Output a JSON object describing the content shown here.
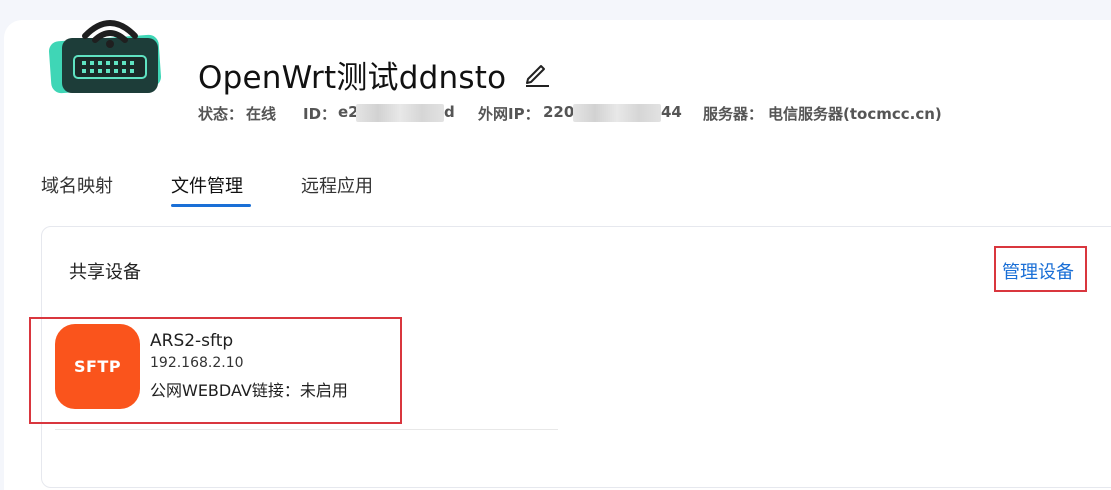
{
  "device": {
    "name": "OpenWrt测试ddnsto",
    "status_label": "状态：",
    "status_value": "在线",
    "id_label": "ID：",
    "id_prefix": "e2",
    "id_suffix": "d",
    "ip_label": "外网IP：",
    "ip_prefix": "220",
    "ip_suffix": "44",
    "server_label": "服务器：",
    "server_value": "电信服务器(tocmcc.cn)"
  },
  "tabs": [
    {
      "label": "域名映射",
      "active": false
    },
    {
      "label": "文件管理",
      "active": true
    },
    {
      "label": "远程应用",
      "active": false
    }
  ],
  "shared": {
    "title": "共享设备",
    "manage_label": "管理设备",
    "items": [
      {
        "badge": "SFTP",
        "name": "ARS2-sftp",
        "ip": "192.168.2.10",
        "webdav_label": "公网WEBDAV链接：",
        "webdav_value": "未启用"
      }
    ]
  },
  "colors": {
    "accent": "#1a6fd6",
    "highlight": "#d9363e",
    "sftp": "#fa541c",
    "router_screen": "#3fd6b6"
  }
}
